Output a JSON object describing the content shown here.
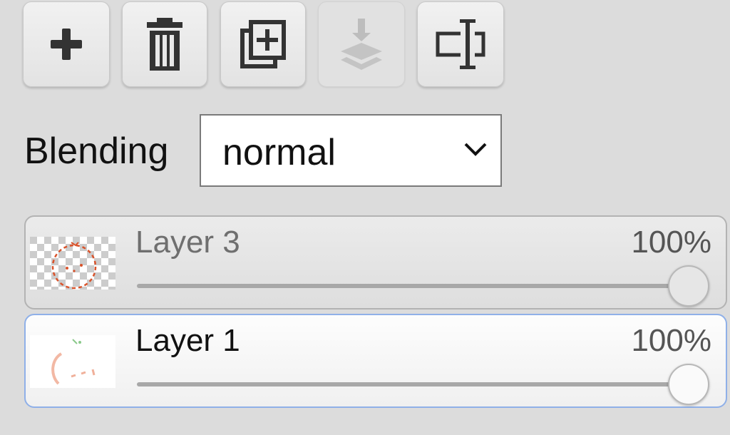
{
  "toolbar": {
    "buttons": [
      {
        "icon": "plus-icon",
        "enabled": true
      },
      {
        "icon": "trash-icon",
        "enabled": true
      },
      {
        "icon": "duplicate-icon",
        "enabled": true
      },
      {
        "icon": "merge-down-icon",
        "enabled": false
      },
      {
        "icon": "rename-icon",
        "enabled": true
      }
    ]
  },
  "blending": {
    "label": "Blending",
    "value": "normal"
  },
  "layers": [
    {
      "name": "Layer 3",
      "opacity_label": "100%",
      "opacity": 1.0,
      "selected": false
    },
    {
      "name": "Layer 1",
      "opacity_label": "100%",
      "opacity": 1.0,
      "selected": true
    }
  ],
  "colors": {
    "selected_border": "#8fb0e8",
    "thumbnail_stroke": "#d9532b"
  }
}
